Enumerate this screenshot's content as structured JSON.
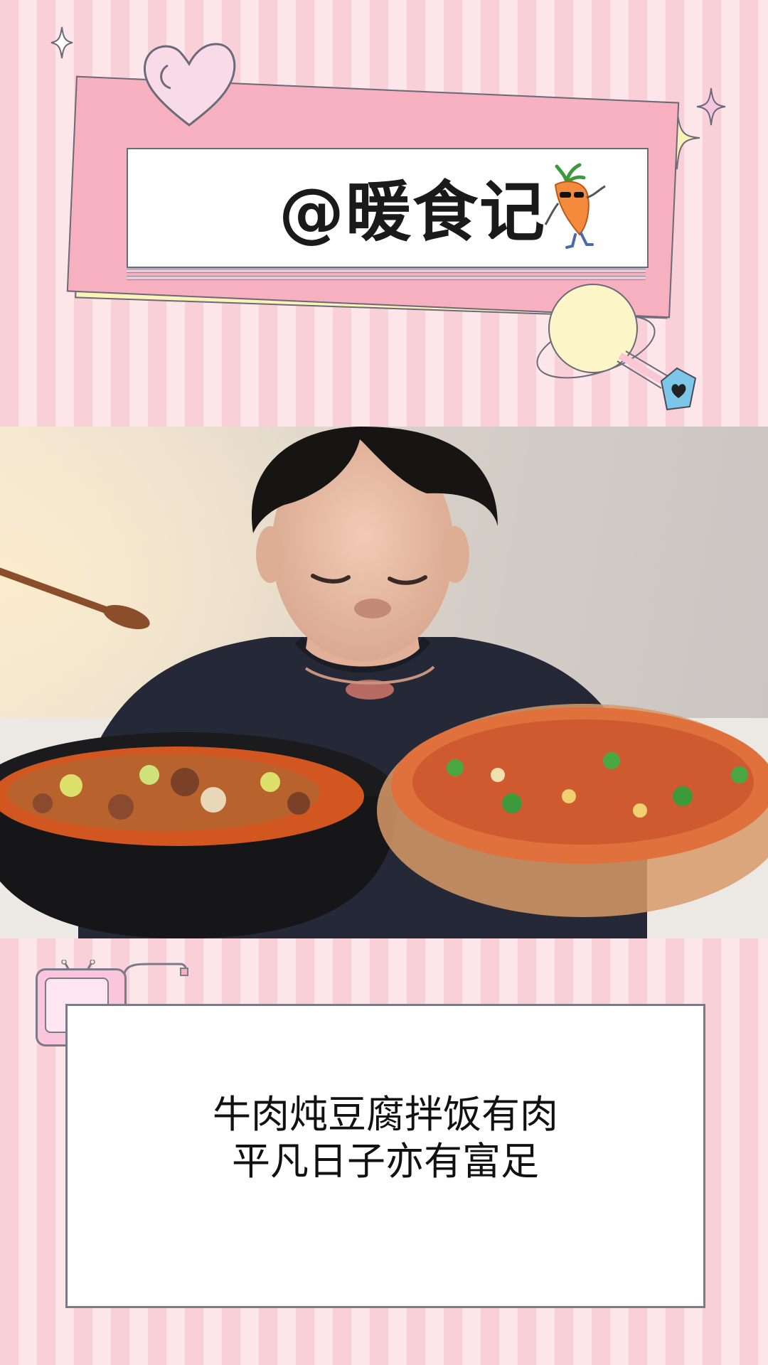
{
  "header": {
    "handle": "@暖食记"
  },
  "caption": {
    "line1": "牛肉炖豆腐拌饭有肉",
    "line2": "平凡日子亦有富足"
  },
  "icons": [
    "sparkle-icon",
    "heart-icon",
    "carrot-mascot-icon",
    "planet-icon",
    "tv-icon",
    "heart-tag-icon"
  ],
  "colors": {
    "stripe_pink": "#f9d0d8",
    "stripe_light": "#fde6ea",
    "card_pink": "#f7b0c0",
    "card_yellow": "#fbf2b8",
    "outline": "#6a6a78",
    "tv_pink": "#fbc5dc",
    "tag_blue": "#7cc6ea"
  }
}
